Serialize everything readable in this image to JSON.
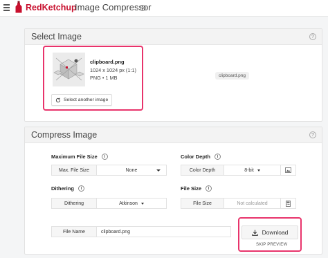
{
  "header": {
    "brand": "RedKetchup",
    "app_title": "Image Compressor"
  },
  "select_card": {
    "title": "Select Image",
    "image": {
      "name": "clipboard.png",
      "dimensions": "1024 x 1024 px (1:1)",
      "meta": "PNG • 1 MB"
    },
    "select_button": "Select another image",
    "chip": "clipboard.png"
  },
  "compress_card": {
    "title": "Compress Image",
    "max_file_size": {
      "label": "Maximum File Size",
      "key": "Max. File Size",
      "value": "None"
    },
    "color_depth": {
      "label": "Color Depth",
      "key": "Color Depth",
      "value": "8-bit"
    },
    "dithering": {
      "label": "Dithering",
      "key": "Dithering",
      "value": "Atkinson"
    },
    "file_size": {
      "label": "File Size",
      "key": "File Size",
      "value": "Not calculated"
    },
    "file_name": {
      "key": "File Name",
      "value": "clipboard.png"
    },
    "download_button": "Download",
    "skip_preview": "SKIP PREVIEW"
  },
  "colors": {
    "brand": "#c8102e",
    "highlight": "#e8336b"
  }
}
